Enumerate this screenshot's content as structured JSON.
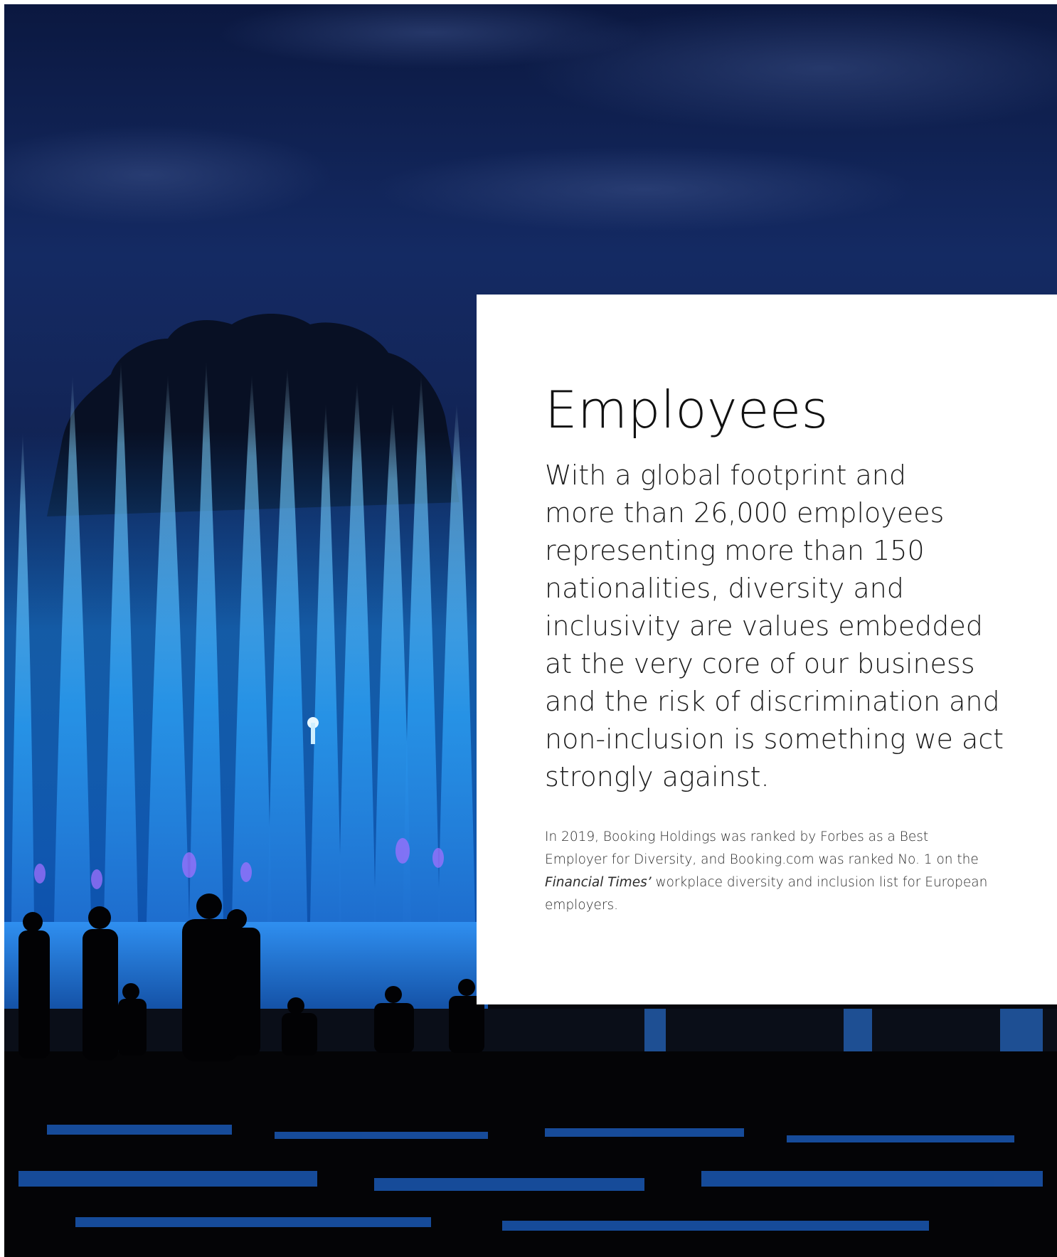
{
  "title": "Employees",
  "lead_lines": [
    "With a global footprint and",
    "more than 26,000 employees",
    "representing more than 150",
    "nationalities, diversity and",
    "inclusivity are values embedded",
    "at the very core of our business",
    "and the risk of discrimination and",
    "non-inclusion is something we act",
    "strongly against."
  ],
  "body": {
    "line1": "In 2019, Booking Holdings was ranked by Forbes as a Best",
    "line2": "Employer for Diversity, and Booking.com was ranked No. 1 on the",
    "line3_italic": "Financial Times’",
    "line3_rest": " workplace diversity and inclusion list for European",
    "line4": "employers."
  },
  "colors": {
    "sky": "#13265a",
    "fountain": "#3fb6ff",
    "card": "#ffffff"
  }
}
